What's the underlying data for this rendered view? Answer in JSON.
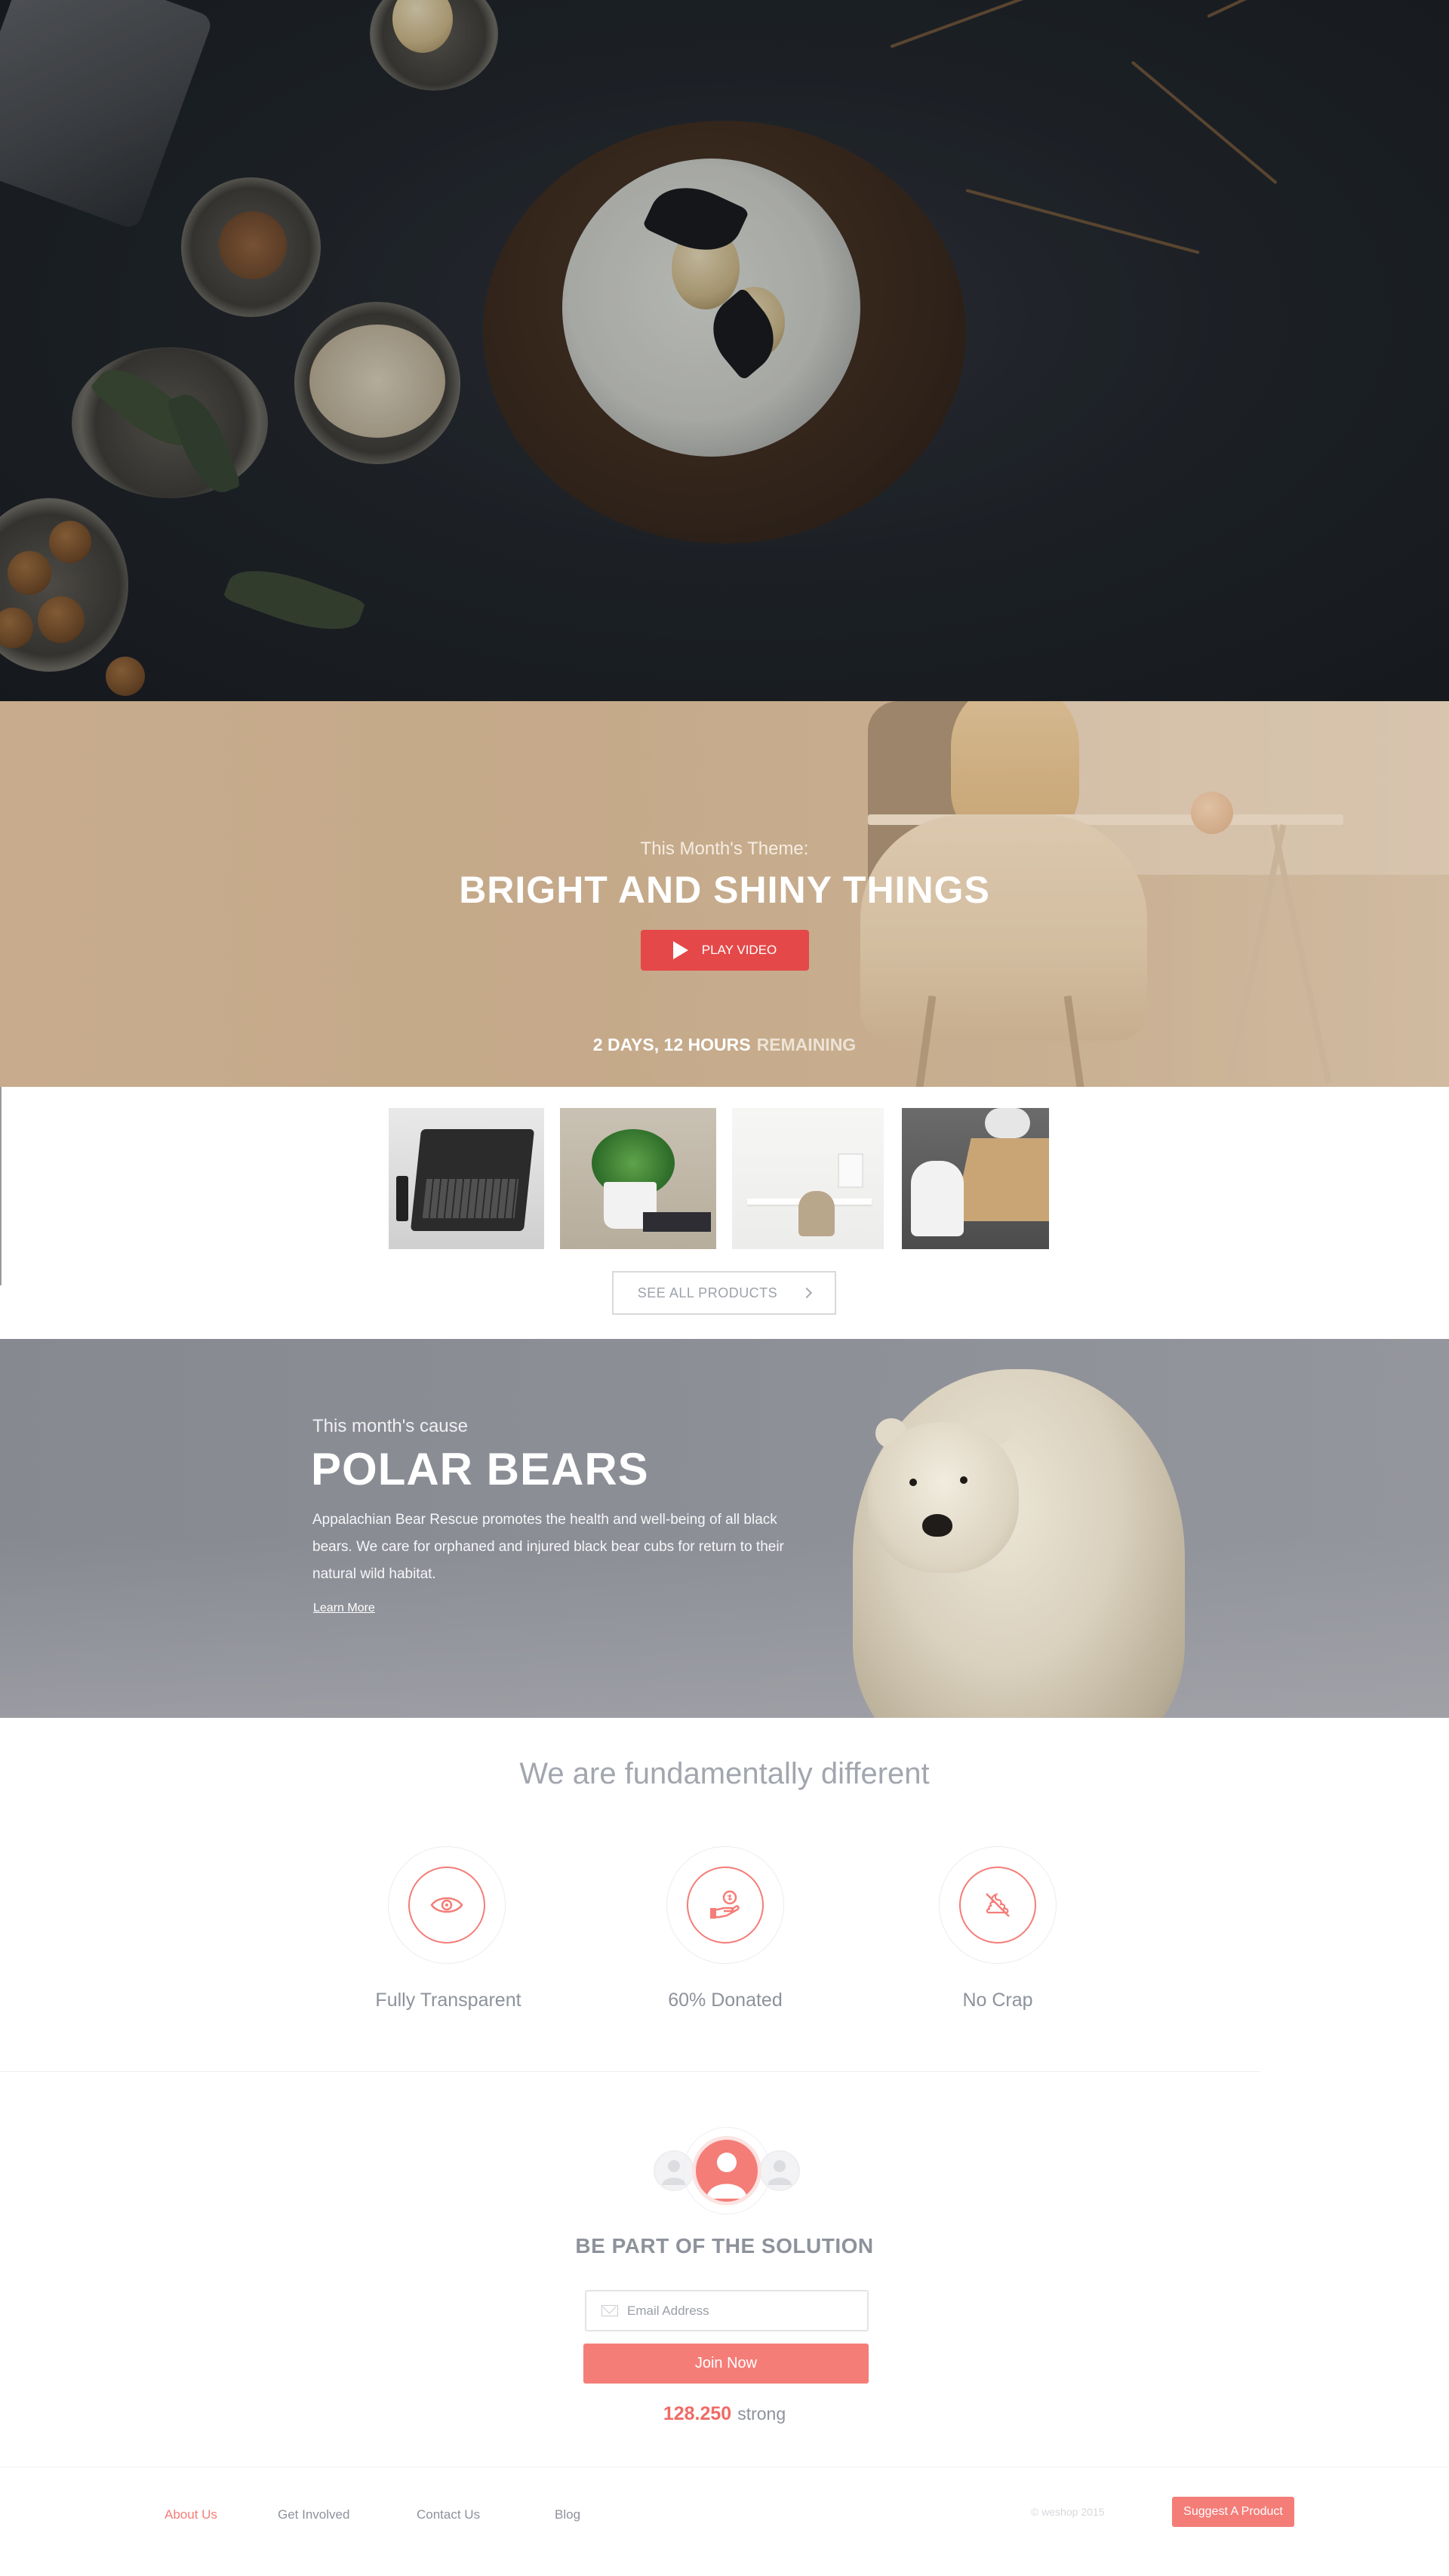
{
  "theme": {
    "subtitle": "This Month's Theme:",
    "title": "BRIGHT AND SHINY THINGS",
    "play_label": "PLAY VIDEO",
    "countdown_time": "2 DAYS, 12 HOURS",
    "countdown_suffix": "REMAINING"
  },
  "products": {
    "thumbnails": [
      "laptop-product",
      "plant-product",
      "desk-product",
      "dining-product"
    ],
    "see_all_label": "SEE ALL PRODUCTS"
  },
  "cause": {
    "subtitle": "This month's cause",
    "title": "POLAR BEARS",
    "body": "Appalachian Bear Rescue promotes the health and well-being of all black bears. We care for orphaned and injured black bear cubs for return to their natural wild habitat.",
    "link": "Learn More"
  },
  "different": {
    "title": "We are fundamentally different",
    "features": [
      {
        "label": "Fully Transparent",
        "icon": "eye-icon"
      },
      {
        "label": "60% Donated",
        "icon": "donation-hand-icon"
      },
      {
        "label": "No Crap",
        "icon": "no-crap-icon"
      }
    ]
  },
  "join": {
    "title": "BE PART OF THE SOLUTION",
    "email_placeholder": "Email Address",
    "button": "Join Now",
    "count": "128.250",
    "count_suffix": "strong"
  },
  "footer": {
    "links": [
      "About Us",
      "Get Involved",
      "Contact Us",
      "Blog"
    ],
    "copyright": "© weshop 2015",
    "suggest_button": "Suggest A Product"
  },
  "colors": {
    "accent": "#f47d78",
    "play_button": "#e54848",
    "text_gray": "#8d929b"
  }
}
